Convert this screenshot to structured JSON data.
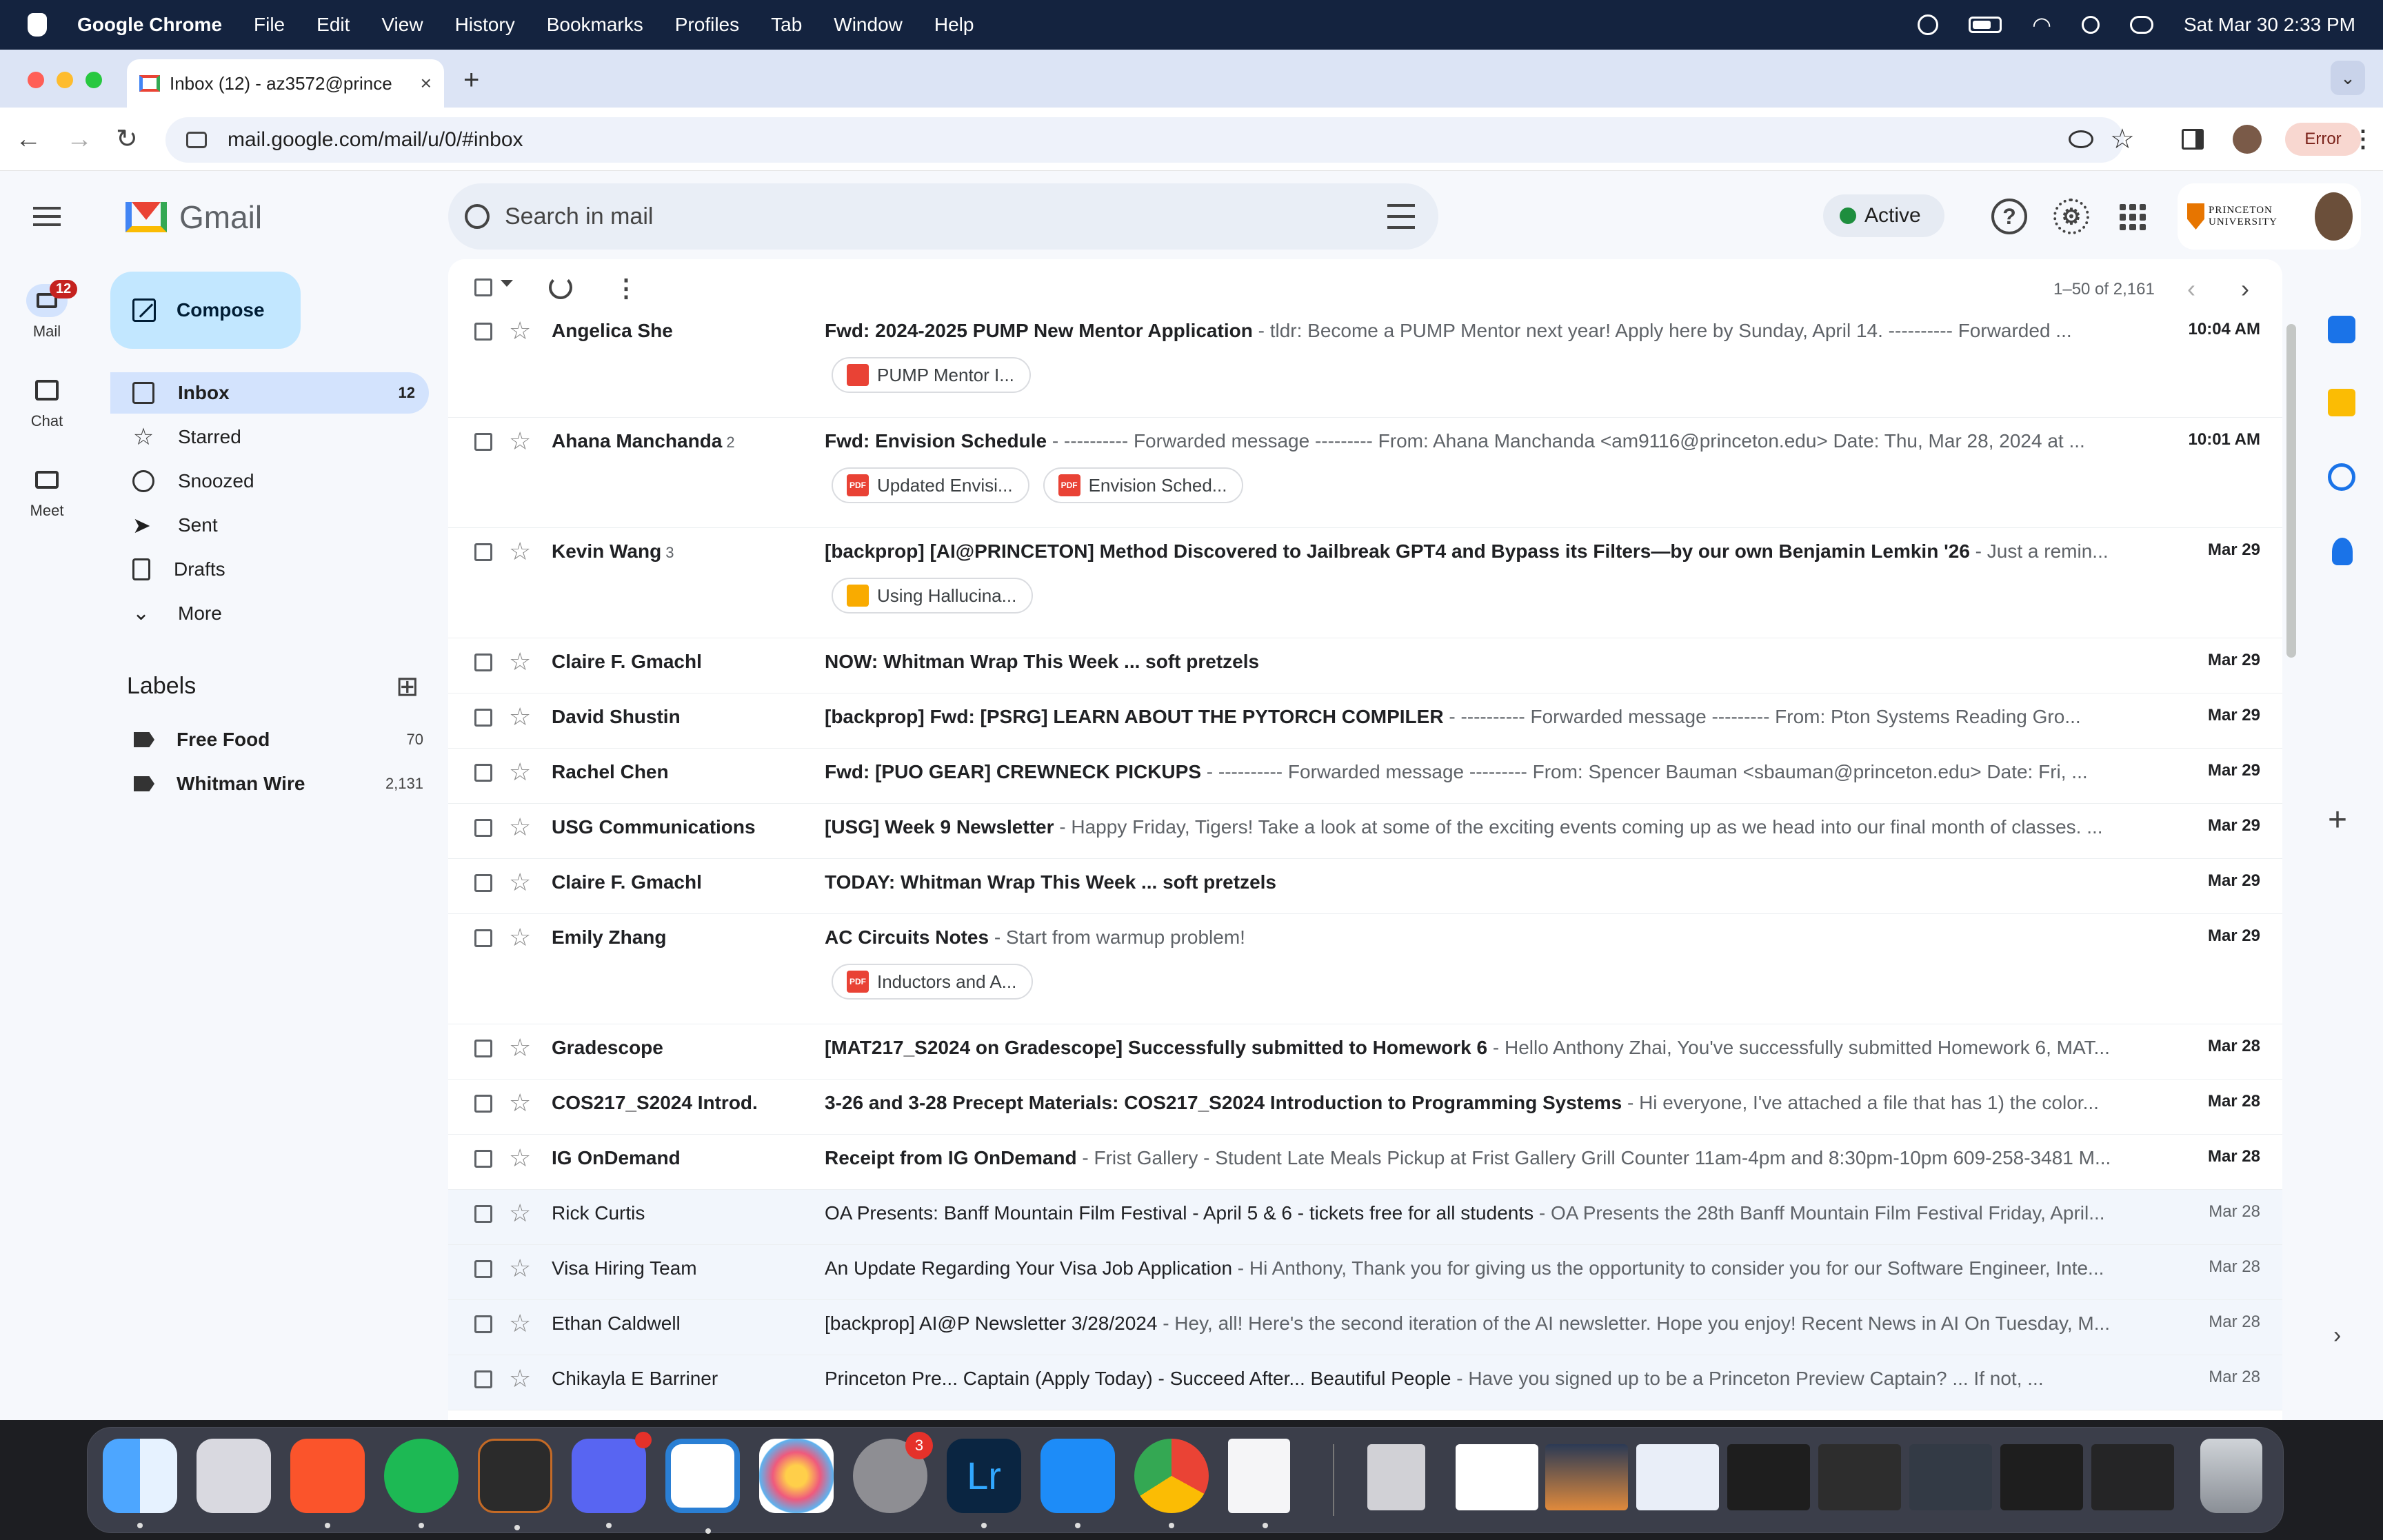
{
  "menubar": {
    "app": "Google Chrome",
    "items": [
      "File",
      "Edit",
      "View",
      "History",
      "Bookmarks",
      "Profiles",
      "Tab",
      "Window",
      "Help"
    ],
    "datetime": "Sat Mar 30  2:33 PM"
  },
  "browser": {
    "tab_title": "Inbox (12) - az3572@prince",
    "url": "mail.google.com/mail/u/0/#inbox",
    "error_label": "Error",
    "new_tab": "+",
    "close_tab": "×"
  },
  "gmail": {
    "logo_text": "Gmail",
    "search_placeholder": "Search in mail",
    "status": "Active",
    "university": "PRINCETON UNIVERSITY",
    "rail": [
      {
        "label": "Mail",
        "badge": "12"
      },
      {
        "label": "Chat"
      },
      {
        "label": "Meet"
      }
    ],
    "compose": "Compose",
    "nav": [
      {
        "label": "Inbox",
        "count": "12"
      },
      {
        "label": "Starred"
      },
      {
        "label": "Snoozed"
      },
      {
        "label": "Sent"
      },
      {
        "label": "Drafts"
      },
      {
        "label": "More"
      }
    ],
    "labels_title": "Labels",
    "labels": [
      {
        "name": "Free Food",
        "count": "70"
      },
      {
        "name": "Whitman Wire",
        "count": "2,131"
      }
    ],
    "range": "1–50 of 2,161",
    "emails": [
      {
        "sender": "Angelica She",
        "n": "",
        "subject": "Fwd: 2024-2025 PUMP New Mentor Application",
        "snippet": " - tldr: Become a PUMP Mentor next year! Apply here by Sunday, April 14. ---------- Forwarded ...",
        "date": "10:04 AM",
        "chips": [
          {
            "label": "PUMP Mentor I...",
            "type": "img"
          }
        ]
      },
      {
        "sender": "Ahana Manchanda",
        "n": "2",
        "subject": "Fwd: Envision Schedule",
        "snippet": " - ---------- Forwarded message --------- From: Ahana Manchanda <am9116@princeton.edu> Date: Thu, Mar 28, 2024 at ...",
        "date": "10:01 AM",
        "chips": [
          {
            "label": "Updated Envisi...",
            "type": "pdf"
          },
          {
            "label": "Envision Sched...",
            "type": "pdf"
          }
        ]
      },
      {
        "sender": "Kevin Wang",
        "n": "3",
        "subject": "[backprop] [AI@PRINCETON] Method Discovered to Jailbreak GPT4 and Bypass its Filters—by our own Benjamin Lemkin '26",
        "snippet": " - Just a remin...",
        "date": "Mar 29",
        "chips": [
          {
            "label": "Using Hallucina...",
            "type": "slide"
          }
        ]
      },
      {
        "sender": "Claire F. Gmachl",
        "n": "",
        "subject": "NOW: Whitman Wrap This Week ... soft pretzels",
        "snippet": "",
        "date": "Mar 29",
        "chips": []
      },
      {
        "sender": "David Shustin",
        "n": "",
        "subject": "[backprop] Fwd: [PSRG] LEARN ABOUT THE PYTORCH COMPILER",
        "snippet": " - ---------- Forwarded message --------- From: Pton Systems Reading Gro...",
        "date": "Mar 29",
        "chips": []
      },
      {
        "sender": "Rachel Chen",
        "n": "",
        "subject": "Fwd: [PUO GEAR] CREWNECK PICKUPS",
        "snippet": " - ---------- Forwarded message --------- From: Spencer Bauman <sbauman@princeton.edu> Date: Fri, ...",
        "date": "Mar 29",
        "chips": []
      },
      {
        "sender": "USG Communications",
        "n": "",
        "subject": "[USG] Week 9 Newsletter",
        "snippet": " - Happy Friday, Tigers! Take a look at some of the exciting events coming up as we head into our final month of classes. ...",
        "date": "Mar 29",
        "chips": []
      },
      {
        "sender": "Claire F. Gmachl",
        "n": "",
        "subject": "TODAY: Whitman Wrap This Week ... soft pretzels",
        "snippet": "",
        "date": "Mar 29",
        "chips": []
      },
      {
        "sender": "Emily Zhang",
        "n": "",
        "subject": "AC Circuits Notes",
        "snippet": " - Start from warmup problem!",
        "date": "Mar 29",
        "chips": [
          {
            "label": "Inductors and A...",
            "type": "pdf"
          }
        ]
      },
      {
        "sender": "Gradescope",
        "n": "",
        "subject": "[MAT217_S2024 on Gradescope] Successfully submitted to Homework 6",
        "snippet": " - Hello Anthony Zhai, You've successfully submitted Homework 6, MAT...",
        "date": "Mar 28",
        "chips": []
      },
      {
        "sender": "COS217_S2024 Introd.",
        "n": "",
        "subject": "3-26 and 3-28 Precept Materials: COS217_S2024 Introduction to Programming Systems",
        "snippet": " - Hi everyone, I've attached a file that has 1) the color...",
        "date": "Mar 28",
        "chips": []
      },
      {
        "sender": "IG OnDemand",
        "n": "",
        "subject": "Receipt from IG OnDemand",
        "snippet": " - Frist Gallery - Student Late Meals Pickup at Frist Gallery Grill Counter 11am-4pm and 8:30pm-10pm 609-258-3481 M...",
        "date": "Mar 28",
        "chips": []
      },
      {
        "sender": "Rick Curtis",
        "n": "",
        "subject": "OA Presents: Banff Mountain Film Festival - April 5 & 6 - tickets free for all students",
        "snippet": " - OA Presents the 28th Banff Mountain Film Festival Friday, April...",
        "date": "Mar 28",
        "chips": []
      },
      {
        "sender": "Visa Hiring Team",
        "n": "",
        "subject": "An Update Regarding Your Visa Job Application",
        "snippet": " - Hi Anthony, Thank you for giving us the opportunity to consider you for our Software Engineer, Inte...",
        "date": "Mar 28",
        "chips": []
      },
      {
        "sender": "Ethan Caldwell",
        "n": "",
        "subject": "[backprop] AI@P Newsletter 3/28/2024",
        "snippet": " - Hey, all! Here's the second iteration of the AI newsletter. Hope you enjoy! Recent News in AI On Tuesday, M...",
        "date": "Mar 28",
        "chips": []
      },
      {
        "sender": "Chikayla E Barriner",
        "n": "",
        "subject": "Princeton Pre... Captain (Apply Today) - Succeed After... Beautiful People",
        "snippet": " - Have you signed up to be a Princeton Preview Captain? ... If not, ...",
        "date": "Mar 28",
        "chips": []
      }
    ]
  },
  "dock_badges": {
    "discord": "",
    "settings": "3"
  }
}
